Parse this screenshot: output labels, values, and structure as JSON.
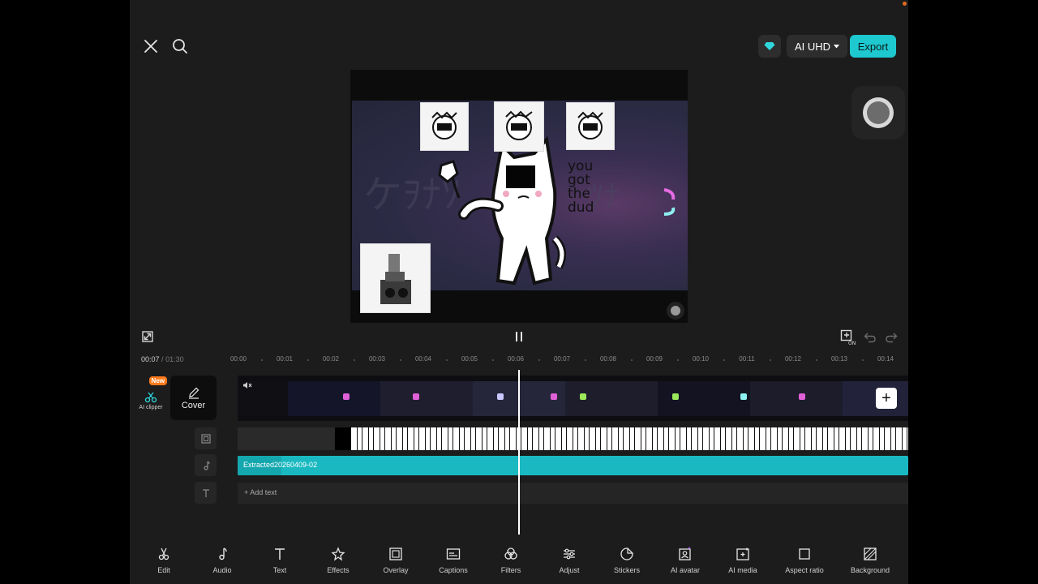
{
  "header": {
    "quality_label": "AI UHD",
    "export_label": "Export"
  },
  "playback": {
    "current_time": "00:07",
    "separator": "/",
    "total_time": "01:30"
  },
  "ruler_ticks": [
    "00:00",
    "00:01",
    "00:02",
    "00:03",
    "00:04",
    "00:05",
    "00:06",
    "00:07",
    "00:08",
    "00:09",
    "00:10",
    "00:11",
    "00:12",
    "00:13",
    "00:14"
  ],
  "left_panel": {
    "ai_clipper_badge": "New",
    "ai_clipper_label": "AI clipper",
    "cover_label": "Cover"
  },
  "tracks": {
    "audio_clip_label": "Extracted20260409-02",
    "add_text_label": "Add text"
  },
  "preview": {
    "overlay_text": "you got the dud"
  },
  "toolbar": {
    "items": [
      {
        "label": "Edit",
        "icon": "scissors-icon"
      },
      {
        "label": "Audio",
        "icon": "music-note-icon"
      },
      {
        "label": "Text",
        "icon": "text-t-icon"
      },
      {
        "label": "Effects",
        "icon": "sparkle-star-icon"
      },
      {
        "label": "Overlay",
        "icon": "overlay-image-icon"
      },
      {
        "label": "Captions",
        "icon": "captions-icon"
      },
      {
        "label": "Filters",
        "icon": "filters-circles-icon"
      },
      {
        "label": "Adjust",
        "icon": "sliders-icon"
      },
      {
        "label": "Stickers",
        "icon": "sticker-icon"
      },
      {
        "label": "AI avatar",
        "icon": "ai-avatar-icon"
      },
      {
        "label": "AI media",
        "icon": "ai-media-icon"
      },
      {
        "label": "Aspect ratio",
        "icon": "aspect-ratio-icon"
      },
      {
        "label": "Background",
        "icon": "background-icon"
      }
    ]
  },
  "colors": {
    "accent": "#1ec8cf",
    "audio_track": "#1ab9c1",
    "new_badge": "#ff7a1a",
    "background": "#1c1c1c"
  }
}
